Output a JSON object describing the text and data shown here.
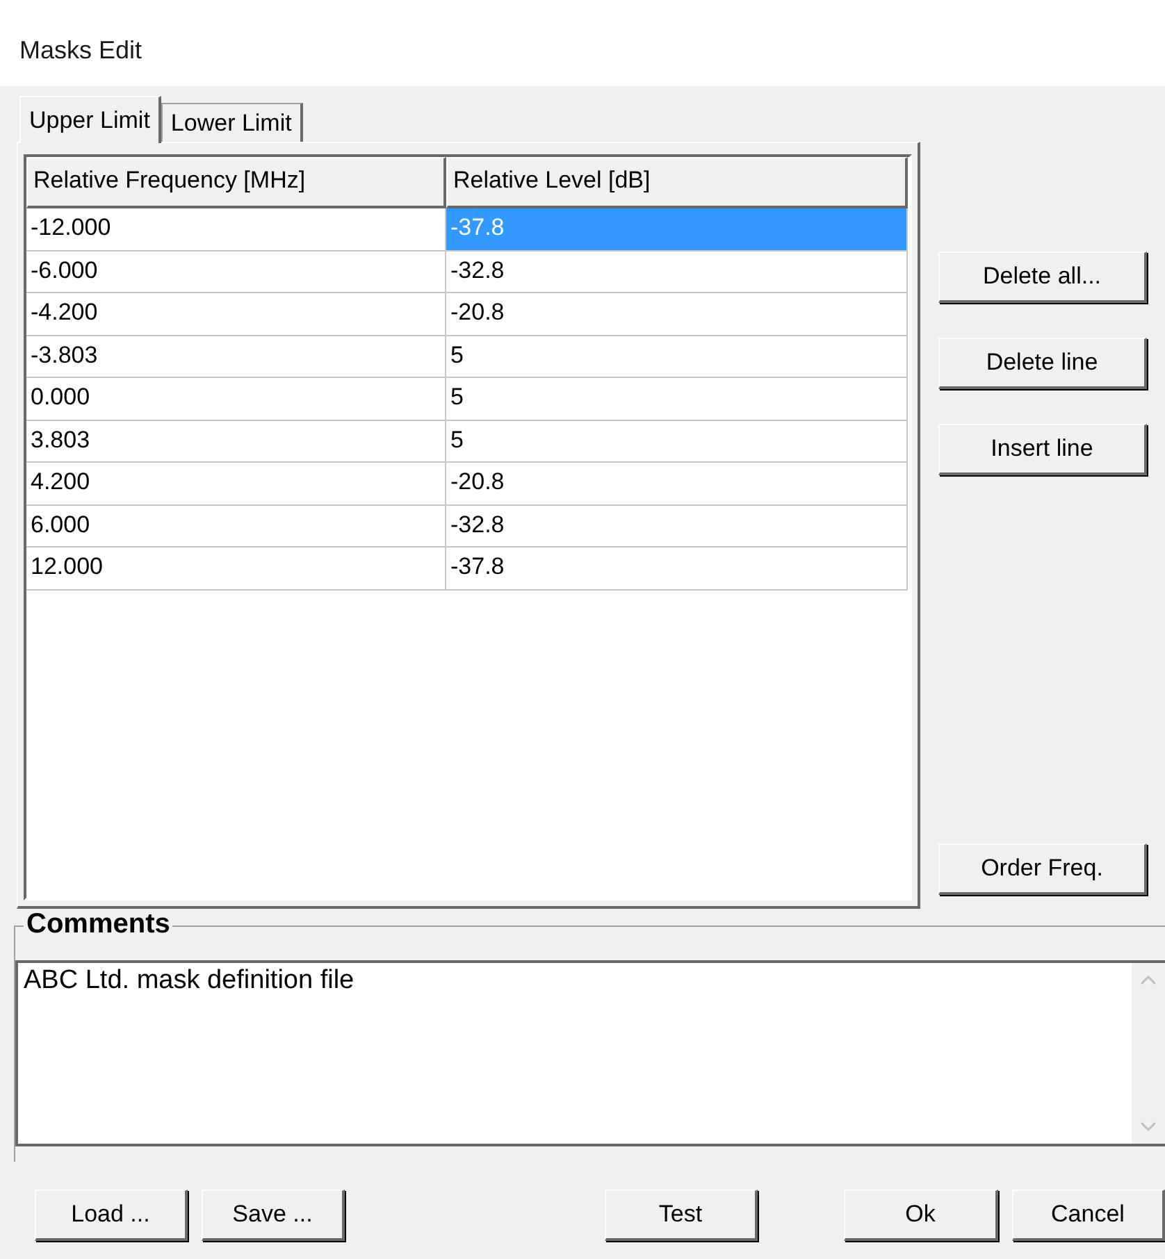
{
  "window": {
    "title": "Masks Edit"
  },
  "tabs": [
    {
      "label": "Upper Limit",
      "selected": true
    },
    {
      "label": "Lower Limit",
      "selected": false
    }
  ],
  "table": {
    "columns": [
      "Relative Frequency [MHz]",
      "Relative Level [dB]"
    ],
    "rows": [
      {
        "cells": [
          {
            "text": "-12.000",
            "selected": false
          },
          {
            "text": "-37.8",
            "selected": true
          }
        ]
      },
      {
        "cells": [
          {
            "text": "-6.000",
            "selected": false
          },
          {
            "text": "-32.8",
            "selected": false
          }
        ]
      },
      {
        "cells": [
          {
            "text": "-4.200",
            "selected": false
          },
          {
            "text": "-20.8",
            "selected": false
          }
        ]
      },
      {
        "cells": [
          {
            "text": "-3.803",
            "selected": false
          },
          {
            "text": "5",
            "selected": false
          }
        ]
      },
      {
        "cells": [
          {
            "text": "0.000",
            "selected": false
          },
          {
            "text": "5",
            "selected": false
          }
        ]
      },
      {
        "cells": [
          {
            "text": "3.803",
            "selected": false
          },
          {
            "text": "5",
            "selected": false
          }
        ]
      },
      {
        "cells": [
          {
            "text": "4.200",
            "selected": false
          },
          {
            "text": "-20.8",
            "selected": false
          }
        ]
      },
      {
        "cells": [
          {
            "text": "6.000",
            "selected": false
          },
          {
            "text": "-32.8",
            "selected": false
          }
        ]
      },
      {
        "cells": [
          {
            "text": "12.000",
            "selected": false
          },
          {
            "text": "-37.8",
            "selected": false
          }
        ]
      }
    ]
  },
  "side_buttons": [
    "Delete all...",
    "Delete line",
    "Insert line"
  ],
  "order_button": "Order Freq.",
  "comments": {
    "label": "Comments",
    "value": "ABC Ltd. mask definition file"
  },
  "bottom_buttons": {
    "left": [
      "Load ...",
      "Save ..."
    ],
    "middle": [
      "Test"
    ],
    "right": [
      "Ok",
      "Cancel"
    ]
  }
}
